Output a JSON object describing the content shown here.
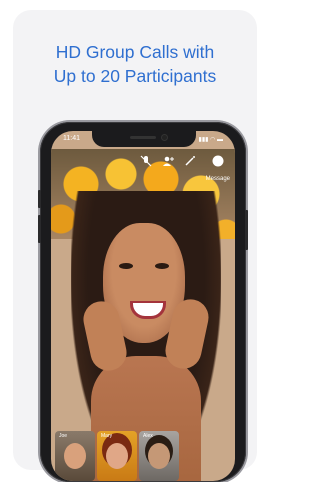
{
  "headline": {
    "line1": "HD Group Calls with",
    "line2": "Up to 20 Participants"
  },
  "status_bar": {
    "time": "11:41"
  },
  "call_controls": {
    "mute_icon": "mic-off-icon",
    "add_user_icon": "add-user-icon",
    "effects_icon": "wand-icon",
    "close_icon": "close-icon",
    "label": "Message"
  },
  "participants": [
    {
      "name": "Joe"
    },
    {
      "name": "Mary"
    },
    {
      "name": "Alex"
    }
  ],
  "colors": {
    "headline": "#2f6fd0",
    "card_background": "#f3f3f5"
  }
}
